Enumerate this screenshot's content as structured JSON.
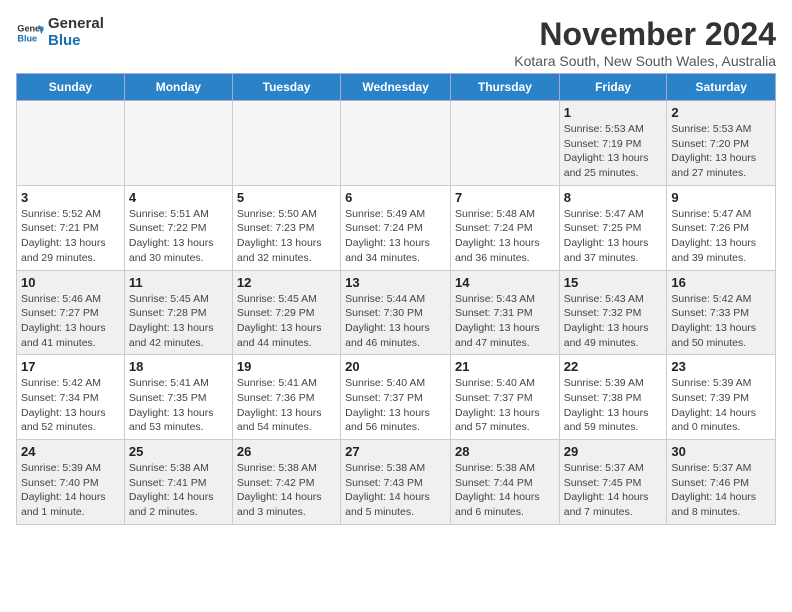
{
  "logo": {
    "text_general": "General",
    "text_blue": "Blue"
  },
  "header": {
    "month": "November 2024",
    "location": "Kotara South, New South Wales, Australia"
  },
  "weekdays": [
    "Sunday",
    "Monday",
    "Tuesday",
    "Wednesday",
    "Thursday",
    "Friday",
    "Saturday"
  ],
  "weeks": [
    [
      {
        "day": "",
        "info": ""
      },
      {
        "day": "",
        "info": ""
      },
      {
        "day": "",
        "info": ""
      },
      {
        "day": "",
        "info": ""
      },
      {
        "day": "",
        "info": ""
      },
      {
        "day": "1",
        "info": "Sunrise: 5:53 AM\nSunset: 7:19 PM\nDaylight: 13 hours\nand 25 minutes."
      },
      {
        "day": "2",
        "info": "Sunrise: 5:53 AM\nSunset: 7:20 PM\nDaylight: 13 hours\nand 27 minutes."
      }
    ],
    [
      {
        "day": "3",
        "info": "Sunrise: 5:52 AM\nSunset: 7:21 PM\nDaylight: 13 hours\nand 29 minutes."
      },
      {
        "day": "4",
        "info": "Sunrise: 5:51 AM\nSunset: 7:22 PM\nDaylight: 13 hours\nand 30 minutes."
      },
      {
        "day": "5",
        "info": "Sunrise: 5:50 AM\nSunset: 7:23 PM\nDaylight: 13 hours\nand 32 minutes."
      },
      {
        "day": "6",
        "info": "Sunrise: 5:49 AM\nSunset: 7:24 PM\nDaylight: 13 hours\nand 34 minutes."
      },
      {
        "day": "7",
        "info": "Sunrise: 5:48 AM\nSunset: 7:24 PM\nDaylight: 13 hours\nand 36 minutes."
      },
      {
        "day": "8",
        "info": "Sunrise: 5:47 AM\nSunset: 7:25 PM\nDaylight: 13 hours\nand 37 minutes."
      },
      {
        "day": "9",
        "info": "Sunrise: 5:47 AM\nSunset: 7:26 PM\nDaylight: 13 hours\nand 39 minutes."
      }
    ],
    [
      {
        "day": "10",
        "info": "Sunrise: 5:46 AM\nSunset: 7:27 PM\nDaylight: 13 hours\nand 41 minutes."
      },
      {
        "day": "11",
        "info": "Sunrise: 5:45 AM\nSunset: 7:28 PM\nDaylight: 13 hours\nand 42 minutes."
      },
      {
        "day": "12",
        "info": "Sunrise: 5:45 AM\nSunset: 7:29 PM\nDaylight: 13 hours\nand 44 minutes."
      },
      {
        "day": "13",
        "info": "Sunrise: 5:44 AM\nSunset: 7:30 PM\nDaylight: 13 hours\nand 46 minutes."
      },
      {
        "day": "14",
        "info": "Sunrise: 5:43 AM\nSunset: 7:31 PM\nDaylight: 13 hours\nand 47 minutes."
      },
      {
        "day": "15",
        "info": "Sunrise: 5:43 AM\nSunset: 7:32 PM\nDaylight: 13 hours\nand 49 minutes."
      },
      {
        "day": "16",
        "info": "Sunrise: 5:42 AM\nSunset: 7:33 PM\nDaylight: 13 hours\nand 50 minutes."
      }
    ],
    [
      {
        "day": "17",
        "info": "Sunrise: 5:42 AM\nSunset: 7:34 PM\nDaylight: 13 hours\nand 52 minutes."
      },
      {
        "day": "18",
        "info": "Sunrise: 5:41 AM\nSunset: 7:35 PM\nDaylight: 13 hours\nand 53 minutes."
      },
      {
        "day": "19",
        "info": "Sunrise: 5:41 AM\nSunset: 7:36 PM\nDaylight: 13 hours\nand 54 minutes."
      },
      {
        "day": "20",
        "info": "Sunrise: 5:40 AM\nSunset: 7:37 PM\nDaylight: 13 hours\nand 56 minutes."
      },
      {
        "day": "21",
        "info": "Sunrise: 5:40 AM\nSunset: 7:37 PM\nDaylight: 13 hours\nand 57 minutes."
      },
      {
        "day": "22",
        "info": "Sunrise: 5:39 AM\nSunset: 7:38 PM\nDaylight: 13 hours\nand 59 minutes."
      },
      {
        "day": "23",
        "info": "Sunrise: 5:39 AM\nSunset: 7:39 PM\nDaylight: 14 hours\nand 0 minutes."
      }
    ],
    [
      {
        "day": "24",
        "info": "Sunrise: 5:39 AM\nSunset: 7:40 PM\nDaylight: 14 hours\nand 1 minute."
      },
      {
        "day": "25",
        "info": "Sunrise: 5:38 AM\nSunset: 7:41 PM\nDaylight: 14 hours\nand 2 minutes."
      },
      {
        "day": "26",
        "info": "Sunrise: 5:38 AM\nSunset: 7:42 PM\nDaylight: 14 hours\nand 3 minutes."
      },
      {
        "day": "27",
        "info": "Sunrise: 5:38 AM\nSunset: 7:43 PM\nDaylight: 14 hours\nand 5 minutes."
      },
      {
        "day": "28",
        "info": "Sunrise: 5:38 AM\nSunset: 7:44 PM\nDaylight: 14 hours\nand 6 minutes."
      },
      {
        "day": "29",
        "info": "Sunrise: 5:37 AM\nSunset: 7:45 PM\nDaylight: 14 hours\nand 7 minutes."
      },
      {
        "day": "30",
        "info": "Sunrise: 5:37 AM\nSunset: 7:46 PM\nDaylight: 14 hours\nand 8 minutes."
      }
    ]
  ]
}
